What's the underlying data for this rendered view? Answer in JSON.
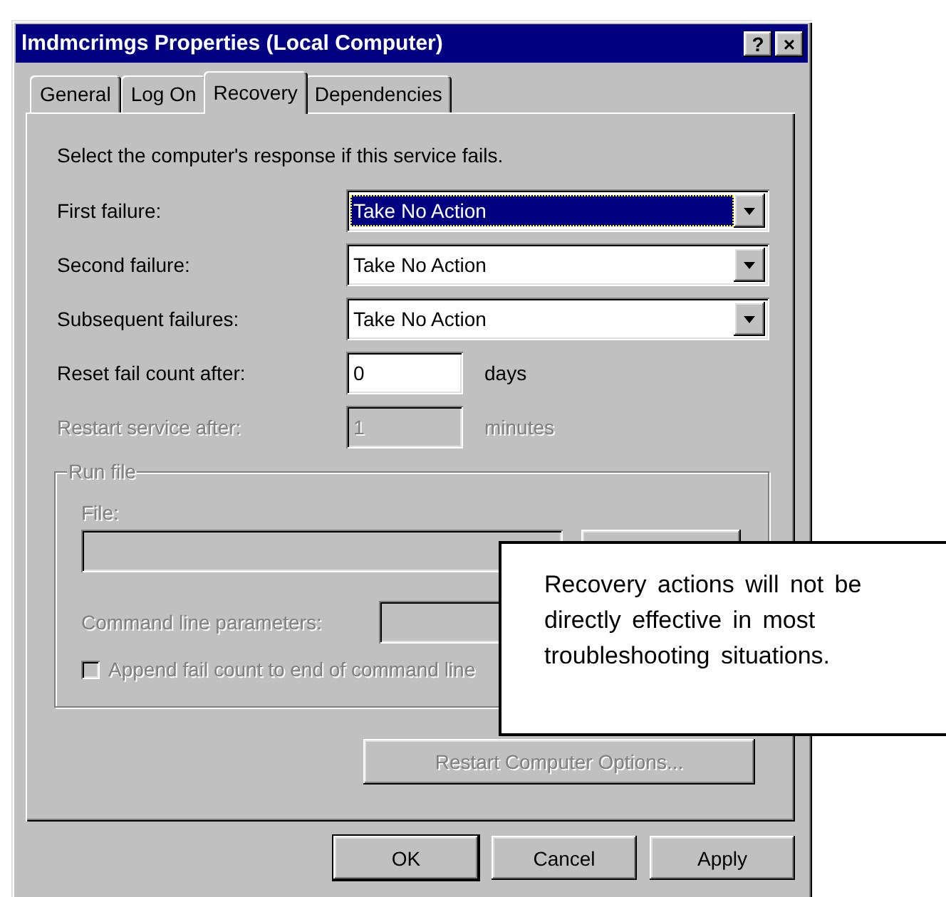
{
  "window": {
    "title": "lmdmcrimgs Properties (Local Computer)",
    "help_button": "?",
    "close_button": "×"
  },
  "tabs": [
    {
      "label": "General",
      "selected": false
    },
    {
      "label": "Log On",
      "selected": false
    },
    {
      "label": "Recovery",
      "selected": true
    },
    {
      "label": "Dependencies",
      "selected": false
    }
  ],
  "intro": "Select the computer's response if this service fails.",
  "failure_actions": [
    {
      "label": "First failure:",
      "value": "Take No Action",
      "focused": true
    },
    {
      "label": "Second failure:",
      "value": "Take No Action",
      "focused": false
    },
    {
      "label": "Subsequent failures:",
      "value": "Take No Action",
      "focused": false
    }
  ],
  "counters": [
    {
      "label": "Reset fail count after:",
      "value": "0",
      "unit": "days",
      "disabled": false
    },
    {
      "label": "Restart service after:",
      "value": "1",
      "unit": "minutes",
      "disabled": true
    }
  ],
  "run_file": {
    "title": "Run file",
    "disabled": true,
    "file_label": "File:",
    "command_label": "Command line parameters:",
    "append_label": "Append fail count to end of command line",
    "append_checked": false
  },
  "restart_computer_button": {
    "label": "Restart Computer Options...",
    "disabled": true
  },
  "buttons": [
    {
      "label": "OK",
      "default": true
    },
    {
      "label": "Cancel",
      "default": false
    },
    {
      "label": "Apply",
      "default": false
    }
  ],
  "callout": {
    "text": "Recovery actions will not be directly effective in most troubleshooting situations."
  }
}
